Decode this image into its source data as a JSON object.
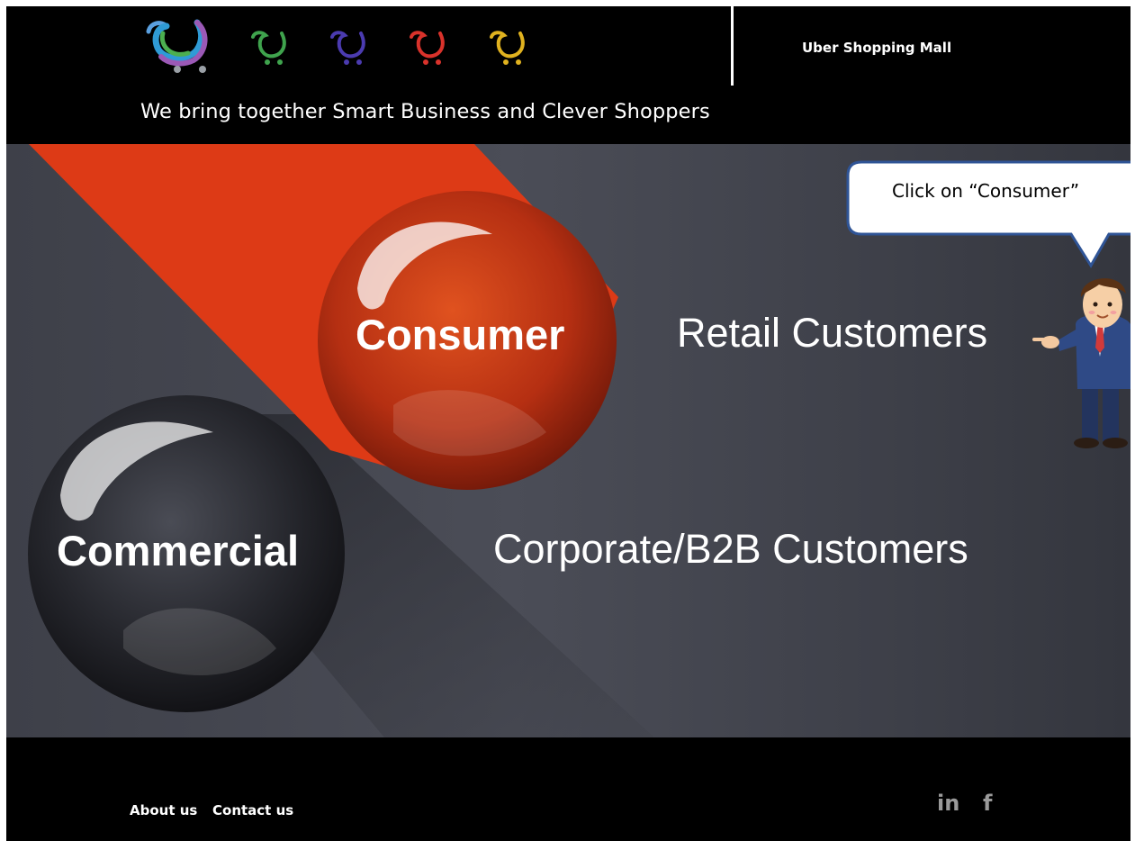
{
  "header": {
    "title": "Uber Shopping Mall",
    "tagline": "We bring together Smart Business and Clever Shoppers",
    "logos": [
      {
        "name": "main-logo-icon",
        "color": "multicolor"
      },
      {
        "name": "green-cart-logo-icon",
        "color": "#3fa34d"
      },
      {
        "name": "purple-cart-logo-icon",
        "color": "#4b3bb0"
      },
      {
        "name": "red-cart-logo-icon",
        "color": "#d9322b"
      },
      {
        "name": "yellow-cart-logo-icon",
        "color": "#e0b21f"
      }
    ]
  },
  "hero": {
    "consumer_label": "Consumer",
    "retail_label": "Retail Customers",
    "commercial_label": "Commercial",
    "corporate_label": "Corporate/B2B Customers",
    "colors": {
      "consumer": "#e03a16",
      "commercial": "#1c1d22",
      "background": "#45474f"
    }
  },
  "callout": {
    "text": "Click on “Consumer”",
    "icon": "pointing-businessman-icon"
  },
  "footer": {
    "about_label": "About us",
    "contact_label": "Contact us",
    "social": [
      {
        "name": "linkedin-icon",
        "glyph": "in"
      },
      {
        "name": "facebook-icon",
        "glyph": "f"
      }
    ]
  }
}
